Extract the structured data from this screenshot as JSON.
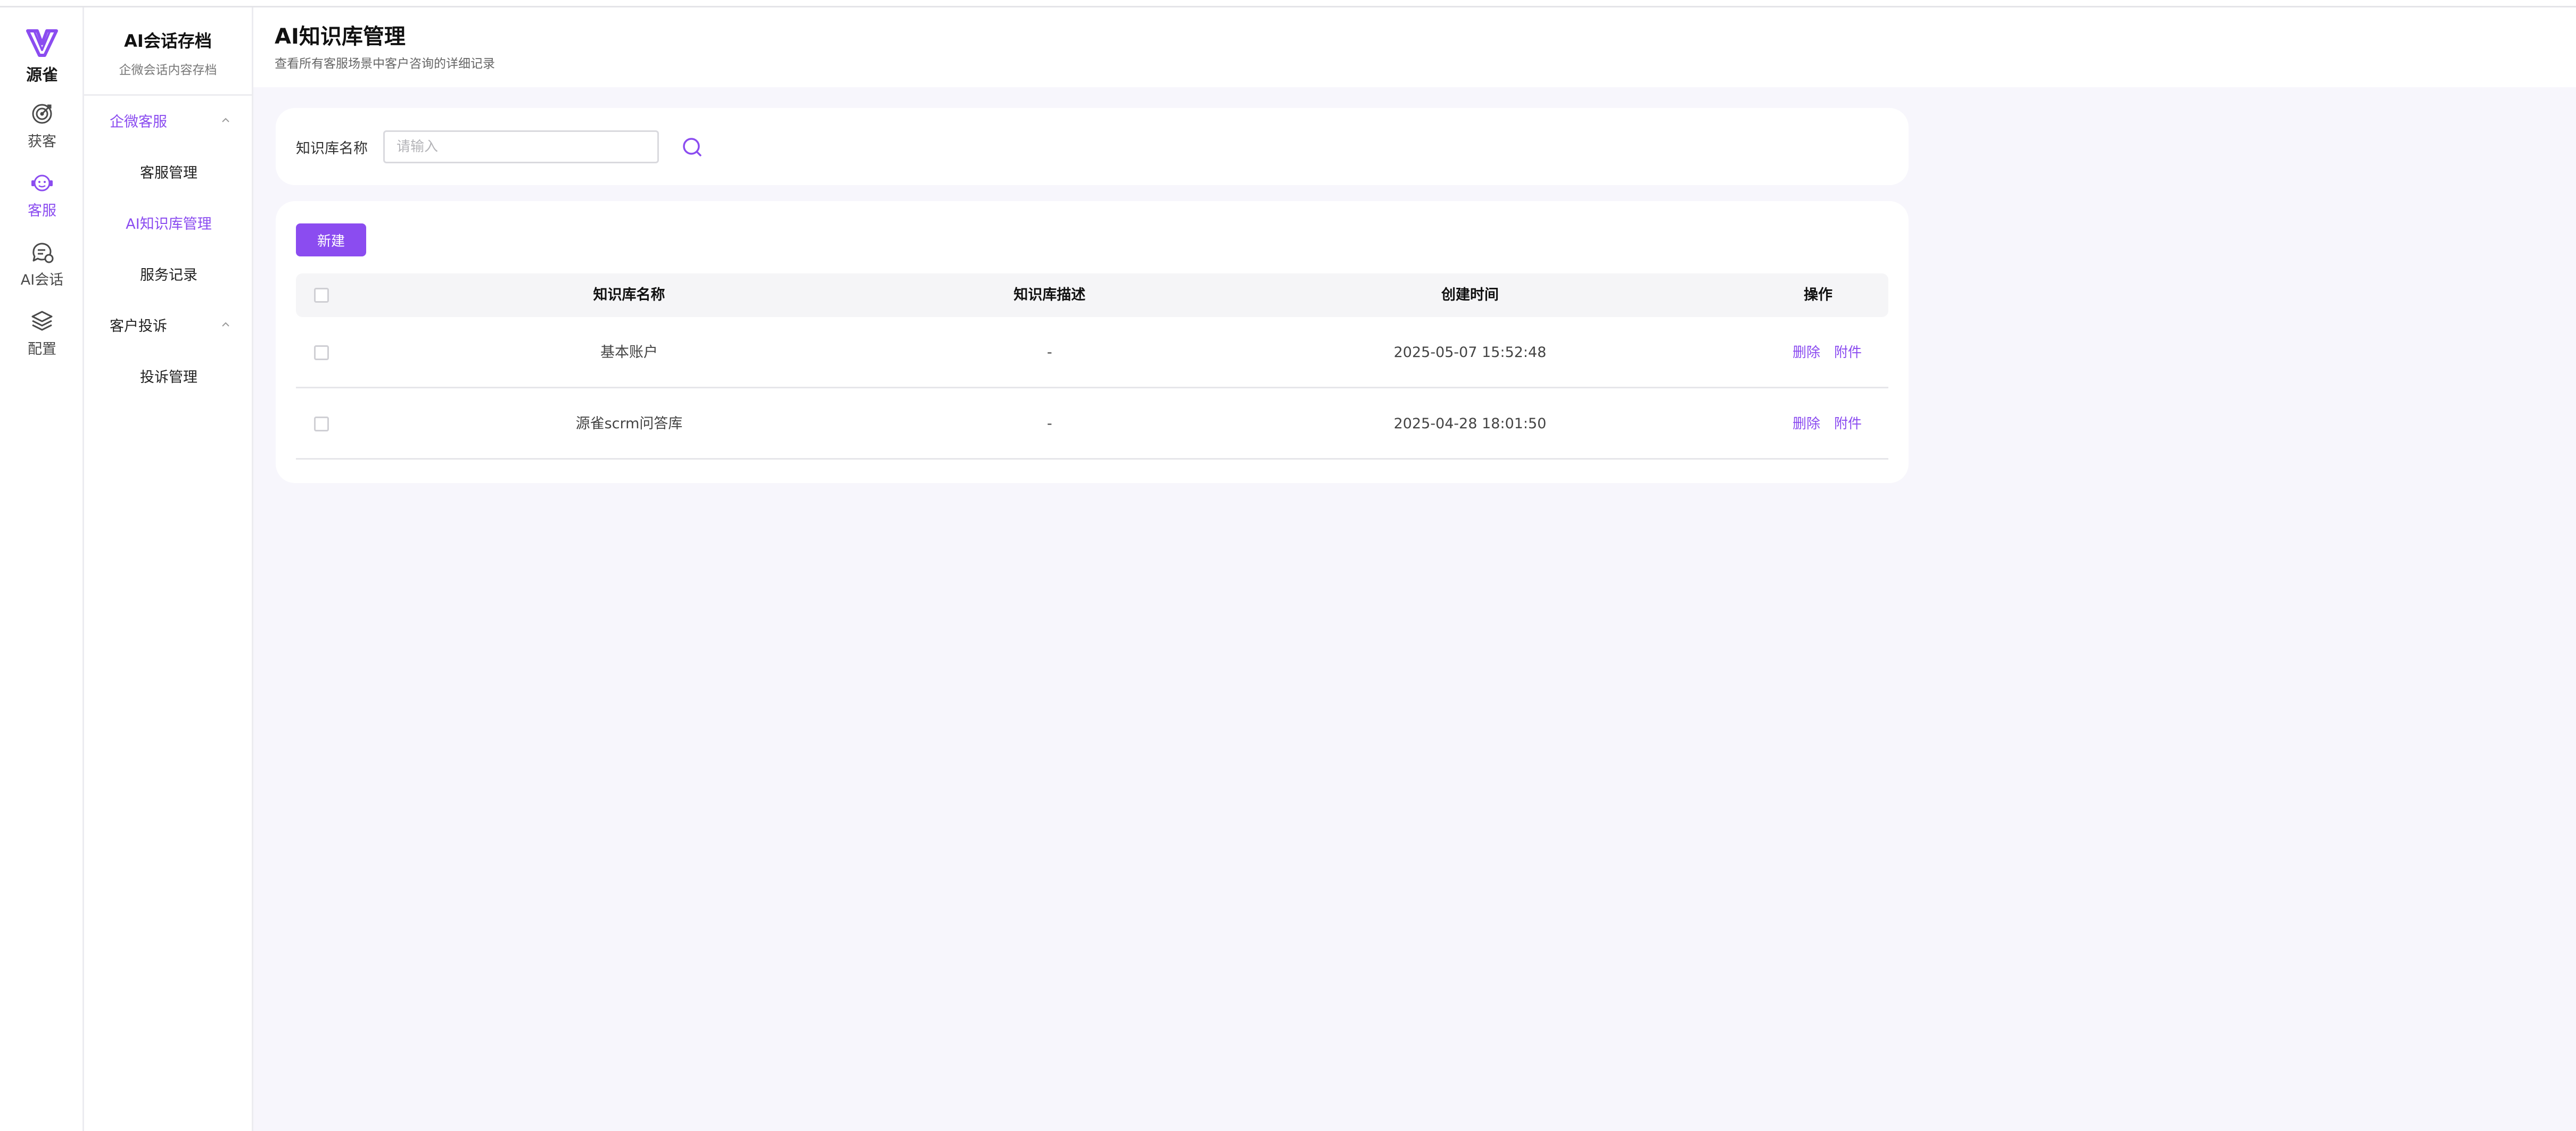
{
  "brand": {
    "name": "源雀",
    "accent": "#8b4cf0"
  },
  "rail": {
    "items": [
      {
        "label": "获客",
        "icon": "target-icon"
      },
      {
        "label": "客服",
        "icon": "customer-service-icon",
        "active": true
      },
      {
        "label": "AI会话",
        "icon": "chat-icon"
      },
      {
        "label": "配置",
        "icon": "layers-icon"
      }
    ]
  },
  "menu": {
    "title": "AI会话存档",
    "subtitle": "企微会话内容存档",
    "groups": [
      {
        "label": "企微客服",
        "expanded": true,
        "active": true,
        "items": [
          {
            "label": "客服管理"
          },
          {
            "label": "AI知识库管理",
            "active": true
          },
          {
            "label": "服务记录"
          }
        ]
      },
      {
        "label": "客户投诉",
        "expanded": true,
        "items": [
          {
            "label": "投诉管理"
          }
        ]
      }
    ]
  },
  "page": {
    "title": "AI知识库管理",
    "subtitle": "查看所有客服场景中客户咨询的详细记录"
  },
  "search": {
    "label": "知识库名称",
    "placeholder": "请输入",
    "value": ""
  },
  "toolbar": {
    "new_label": "新建"
  },
  "table": {
    "columns": [
      "知识库名称",
      "知识库描述",
      "创建时间",
      "操作"
    ],
    "rows": [
      {
        "name": "基本账户",
        "desc": "-",
        "created": "2025-05-07 15:52:48",
        "actions": [
          "删除",
          "附件"
        ]
      },
      {
        "name": "源雀scrm问答库",
        "desc": "-",
        "created": "2025-04-28 18:01:50",
        "actions": [
          "删除",
          "附件"
        ]
      }
    ]
  }
}
